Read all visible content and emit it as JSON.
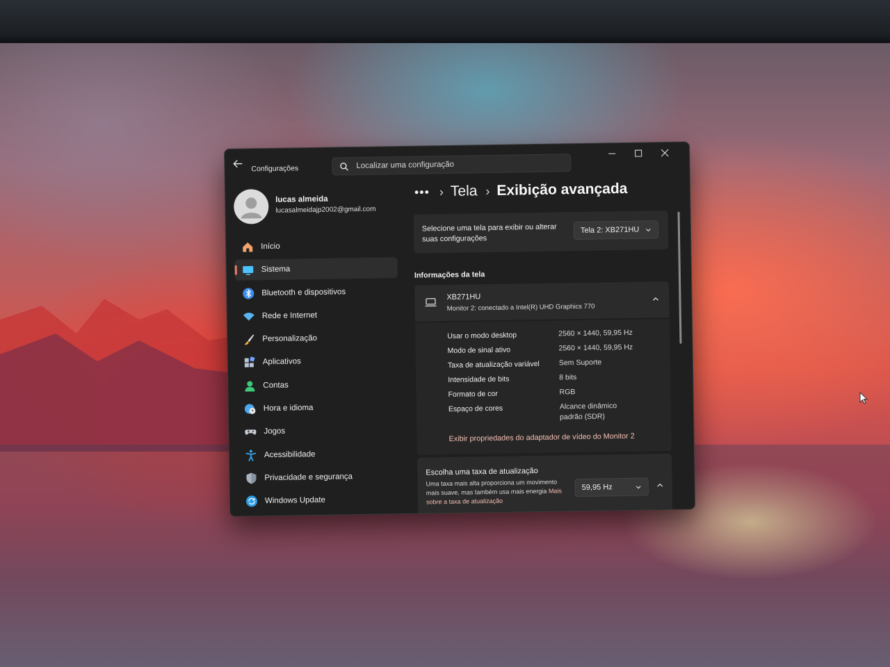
{
  "window": {
    "app_title": "Configurações",
    "search_placeholder": "Localizar uma configuração"
  },
  "user": {
    "name": "lucas almeida",
    "email": "lucasalmeidajp2002@gmail.com"
  },
  "sidebar": {
    "items": [
      {
        "label": "Início",
        "icon": "home-icon",
        "color": "#f4a46a",
        "active": false
      },
      {
        "label": "Sistema",
        "icon": "system-icon",
        "color": "#4cc2ff",
        "active": true
      },
      {
        "label": "Bluetooth e dispositivos",
        "icon": "bluetooth-icon",
        "color": "#3b8eea",
        "active": false
      },
      {
        "label": "Rede e Internet",
        "icon": "wifi-icon",
        "color": "#5ab4f0",
        "active": false
      },
      {
        "label": "Personalização",
        "icon": "brush-icon",
        "color": "#f0b429",
        "active": false
      },
      {
        "label": "Aplicativos",
        "icon": "apps-icon",
        "color": "#b9c4d6",
        "active": false
      },
      {
        "label": "Contas",
        "icon": "account-icon",
        "color": "#3ec97a",
        "active": false
      },
      {
        "label": "Hora e idioma",
        "icon": "globe-clock-icon",
        "color": "#4aa8f0",
        "active": false
      },
      {
        "label": "Jogos",
        "icon": "gamepad-icon",
        "color": "#c7cbd3",
        "active": false
      },
      {
        "label": "Acessibilidade",
        "icon": "accessibility-icon",
        "color": "#37a6ee",
        "active": false
      },
      {
        "label": "Privacidade e segurança",
        "icon": "shield-icon",
        "color": "#a9b3bf",
        "active": false
      },
      {
        "label": "Windows Update",
        "icon": "update-icon",
        "color": "#2f9de4",
        "active": false
      }
    ]
  },
  "breadcrumb": {
    "more": "•••",
    "separator": "›",
    "parent": "Tela",
    "current": "Exibição avançada"
  },
  "select_display": {
    "text": "Selecione uma tela para exibir ou alterar suas configurações",
    "value": "Tela 2: XB271HU"
  },
  "display_info": {
    "section_title": "Informações da tela",
    "monitor_name": "XB271HU",
    "monitor_subtitle": "Monitor 2: conectado a Intel(R) UHD Graphics 770",
    "rows": [
      {
        "label": "Usar o modo desktop",
        "value": "2560 × 1440, 59,95 Hz"
      },
      {
        "label": "Modo de sinal ativo",
        "value": "2560 × 1440, 59,95 Hz"
      },
      {
        "label": "Taxa de atualização variável",
        "value": "Sem Suporte"
      },
      {
        "label": "Intensidade de bits",
        "value": "8 bits"
      },
      {
        "label": "Formato de cor",
        "value": "RGB"
      },
      {
        "label": "Espaço de cores",
        "value": "Alcance dinâmico padrão (SDR)"
      }
    ],
    "adapter_link": "Exibir propriedades do adaptador de vídeo do Monitor 2"
  },
  "refresh_rate": {
    "title": "Escolha uma taxa de atualização",
    "description": "Uma taxa mais alta proporciona um movimento mais suave, mas também usa mais energia",
    "link": "Mais sobre a taxa de atualização",
    "value": "59,95 Hz"
  },
  "colors": {
    "accent": "#f07c6a",
    "link": "#f6c1b5",
    "window_bg": "#1f1f1f",
    "card_bg": "#2b2b2b"
  }
}
